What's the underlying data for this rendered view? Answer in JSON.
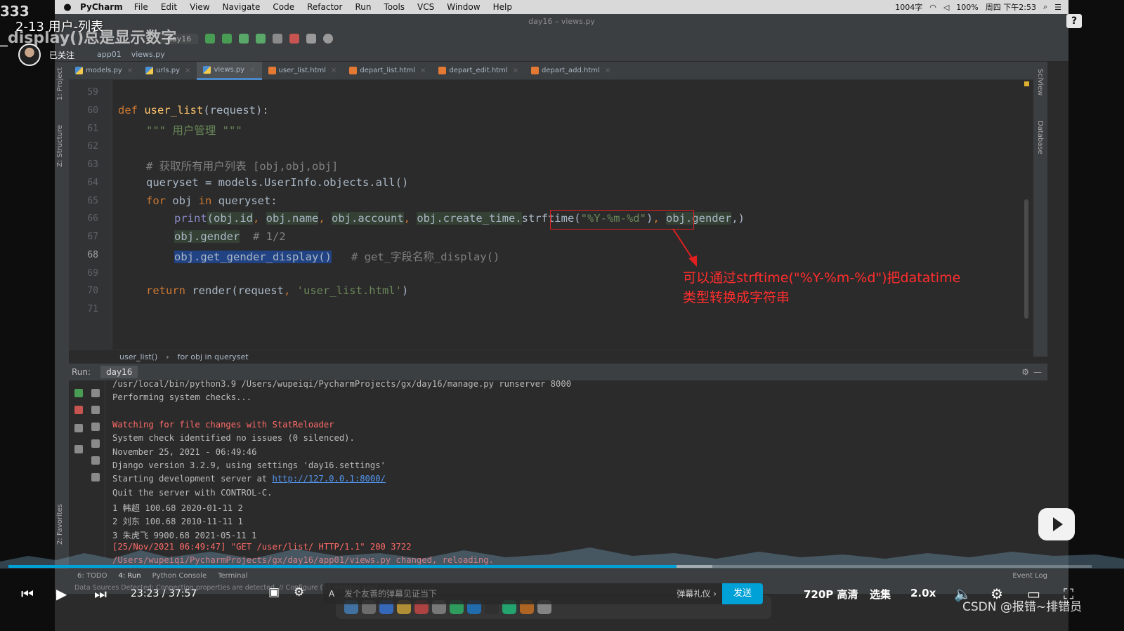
{
  "menubar": {
    "app_name": "PyCharm",
    "items": [
      "File",
      "Edit",
      "View",
      "Navigate",
      "Code",
      "Refactor",
      "Run",
      "Tools",
      "VCS",
      "Window",
      "Help"
    ],
    "status_words": "1004字",
    "battery": "100%",
    "clock": "周四 下午2:53"
  },
  "ide": {
    "window_title": "day16 – views.py",
    "run_config": "day16",
    "breadcrumb": [
      "app01",
      "views.py"
    ],
    "tabs": [
      {
        "label": "models.py",
        "type": "py",
        "active": false
      },
      {
        "label": "urls.py",
        "type": "py",
        "active": false
      },
      {
        "label": "views.py",
        "type": "py",
        "active": true
      },
      {
        "label": "user_list.html",
        "type": "html",
        "active": false
      },
      {
        "label": "depart_list.html",
        "type": "html",
        "active": false
      },
      {
        "label": "depart_edit.html",
        "type": "html",
        "active": false
      },
      {
        "label": "depart_add.html",
        "type": "html",
        "active": false
      }
    ],
    "left_tools": [
      "1: Project",
      "Z: Structure",
      "2: Favorites"
    ],
    "right_tools": [
      "SciView",
      "Database"
    ],
    "line_numbers": [
      "59",
      "60",
      "61",
      "62",
      "63",
      "64",
      "65",
      "66",
      "67",
      "68",
      "69",
      "70",
      "71"
    ],
    "current_line": "68",
    "code_crumb": [
      "user_list()",
      "for obj in queryset"
    ],
    "annotation": {
      "line1": "可以通过strftime(\"%Y-%m-%d\")把datatime",
      "line2": "类型转换成字符串"
    }
  },
  "code": {
    "l60": {
      "kw": "def ",
      "fn": "user_list",
      "rest": "(request):"
    },
    "l61": "\"\"\" 用户管理 \"\"\"",
    "l63": "# 获取所有用户列表 [obj,obj,obj]",
    "l64": "queryset = models.UserInfo.objects.all()",
    "l65": {
      "kw1": "for ",
      "mid": "obj ",
      "kw2": "in ",
      "rest": "queryset:"
    },
    "l66": {
      "print": "print",
      "a": "(obj.id",
      "c1": ", ",
      "b": "obj.name",
      "c2": ", ",
      "c": "obj.account",
      "c3": ", ",
      "d": "obj.create_time.",
      "e": "strftime(",
      "f": "\"%Y-%m-%d\"",
      "g": ")",
      "c4": ", ",
      "h": "obj.gender",
      "i": ",)"
    },
    "l67": {
      "a": "obj.gender",
      "cm": "  # 1/2"
    },
    "l68": {
      "a": "obj.get_gender_display()",
      "cm": "   # get_字段名称_display()"
    },
    "l70": {
      "kw": "return ",
      "a": "render(request",
      "c": ", ",
      "s": "'user_list.html'",
      "e": ")"
    }
  },
  "run": {
    "label": "Run:",
    "tab": "day16",
    "lines": [
      {
        "text": "/usr/local/bin/python3.9 /Users/wupeiqi/PycharmProjects/gx/day16/manage.py runserver 8000",
        "style": "normal"
      },
      {
        "text": "Performing system checks...",
        "style": "normal"
      },
      {
        "text": "",
        "style": "normal"
      },
      {
        "text": "Watching for file changes with StatReloader",
        "style": "red"
      },
      {
        "text": "System check identified no issues (0 silenced).",
        "style": "normal"
      },
      {
        "text": "November 25, 2021 - 06:49:46",
        "style": "normal"
      },
      {
        "text": "Django version 3.2.9, using settings 'day16.settings'",
        "style": "normal"
      },
      {
        "text": "Starting development server at ",
        "style": "normal",
        "link": "http://127.0.0.1:8000/"
      },
      {
        "text": "Quit the server with CONTROL-C.",
        "style": "normal"
      },
      {
        "text": "1 韩超 100.68 2020-01-11 2",
        "style": "normal"
      },
      {
        "text": "2 刘东 100.68 2010-11-11 1",
        "style": "normal"
      },
      {
        "text": "3 朱虎飞 9900.68 2021-05-11 1",
        "style": "normal"
      },
      {
        "text": "[25/Nov/2021 06:49:47] \"GET /user/list/ HTTP/1.1\" 200 3722",
        "style": "red"
      },
      {
        "text": "/Users/wupeiqi/PycharmProjects/gx/day16/app01/views.py changed, reloading.",
        "style": "red"
      }
    ]
  },
  "ide_bottom": {
    "tabs": [
      "6: TODO",
      "4: Run",
      "Python Console",
      "Terminal"
    ],
    "event_log": "Event Log",
    "status": "Data Sources Detected: Connection properties are detected. // Configure (51 minutes ago)"
  },
  "player": {
    "top_code": "333",
    "title": "2-13 用户-列表",
    "sub_overlay": "_display()总是显示数字",
    "follow_label": "已关注",
    "help": "?",
    "time": "23:23 / 37:57",
    "progress": 0.617,
    "buffered": 0.65,
    "danmu_placeholder": "发个友善的弹幕见证当下",
    "danmu_gift": "弹幕礼仪 ›",
    "send": "发送",
    "quality": "720P 高清",
    "episodes": "选集",
    "speed": "2.0x",
    "watermark": "CSDN @报错~排错员"
  }
}
